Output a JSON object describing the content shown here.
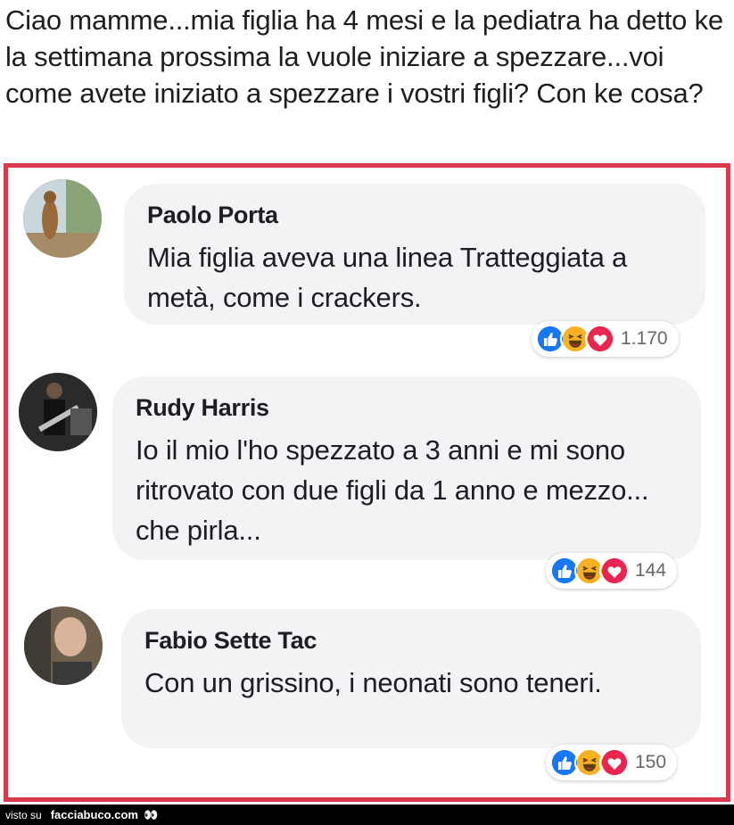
{
  "post": {
    "text": "Ciao mamme...mia figlia ha 4 mesi e la pediatra ha detto ke la settimana prossima la vuole iniziare a spezzare...voi come avete iniziato a spezzare i vostri figli? Con ke cosa?"
  },
  "comments": [
    {
      "author": "Paolo Porta",
      "text": "Mia figlia aveva una linea Tratteggiata a metà, come i crackers.",
      "reaction_count": "1.170",
      "reactions": [
        "like-icon",
        "haha-icon",
        "love-icon"
      ]
    },
    {
      "author": "Rudy Harris",
      "text": "Io il mio l'ho spezzato a 3 anni e mi sono ritrovato con due figli da 1 anno e mezzo... che pirla...",
      "reaction_count": "144",
      "reactions": [
        "like-icon",
        "haha-icon",
        "love-icon"
      ]
    },
    {
      "author": "Fabio Sette Tac",
      "text": "Con un grissino, i neonati sono teneri.",
      "reaction_count": "150",
      "reactions": [
        "like-icon",
        "haha-icon",
        "love-icon"
      ]
    }
  ],
  "footer": {
    "prefix": "visto su",
    "brand": "facciabuco.com",
    "eyes": "👀"
  },
  "colors": {
    "frame": "#d9394b",
    "bubble": "#f2f3f5",
    "like": "#1877f2",
    "haha": "#f7b125",
    "love": "#e8264f"
  }
}
